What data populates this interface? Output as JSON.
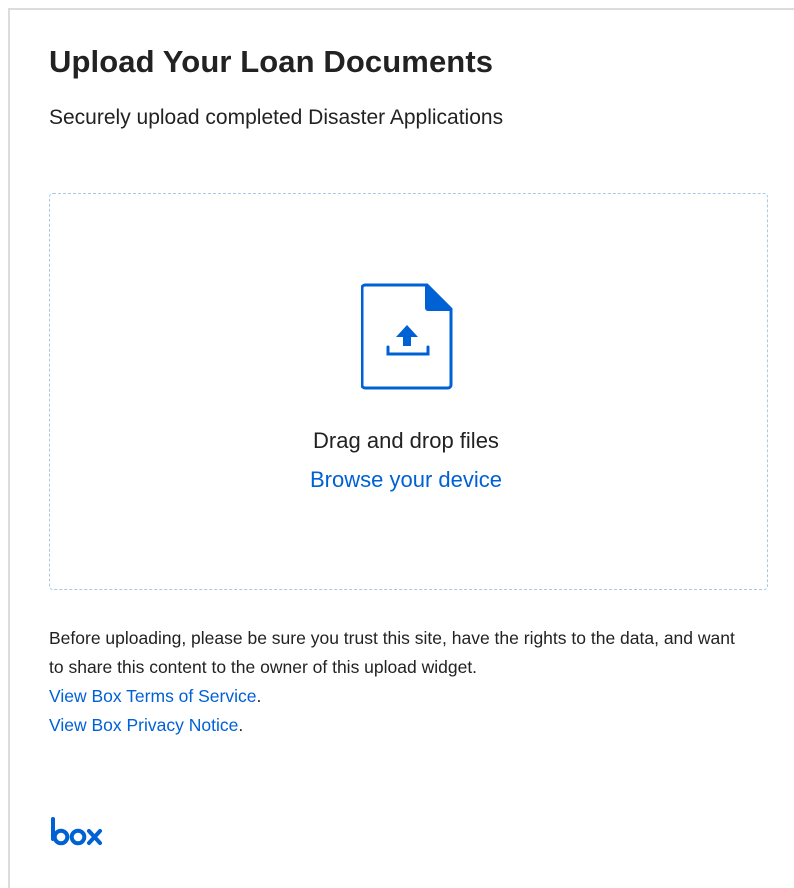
{
  "header": {
    "title": "Upload Your Loan Documents",
    "subtitle": "Securely upload completed Disaster Applications"
  },
  "dropzone": {
    "icon": "file-upload-icon",
    "drag_text": "Drag and drop files",
    "browse_label": "Browse your device"
  },
  "notice": {
    "text": "Before uploading, please be sure you trust this site, have the rights to the data, and want to share this content to the owner of this upload widget.",
    "terms_link": "View Box Terms of Service",
    "privacy_link": "View Box Privacy Notice",
    "period": "."
  },
  "footer": {
    "logo_icon": "box-logo-icon",
    "logo_text": "box"
  },
  "colors": {
    "accent": "#0061d5",
    "text": "#222222",
    "dropzone_border": "#a9c8e6"
  }
}
